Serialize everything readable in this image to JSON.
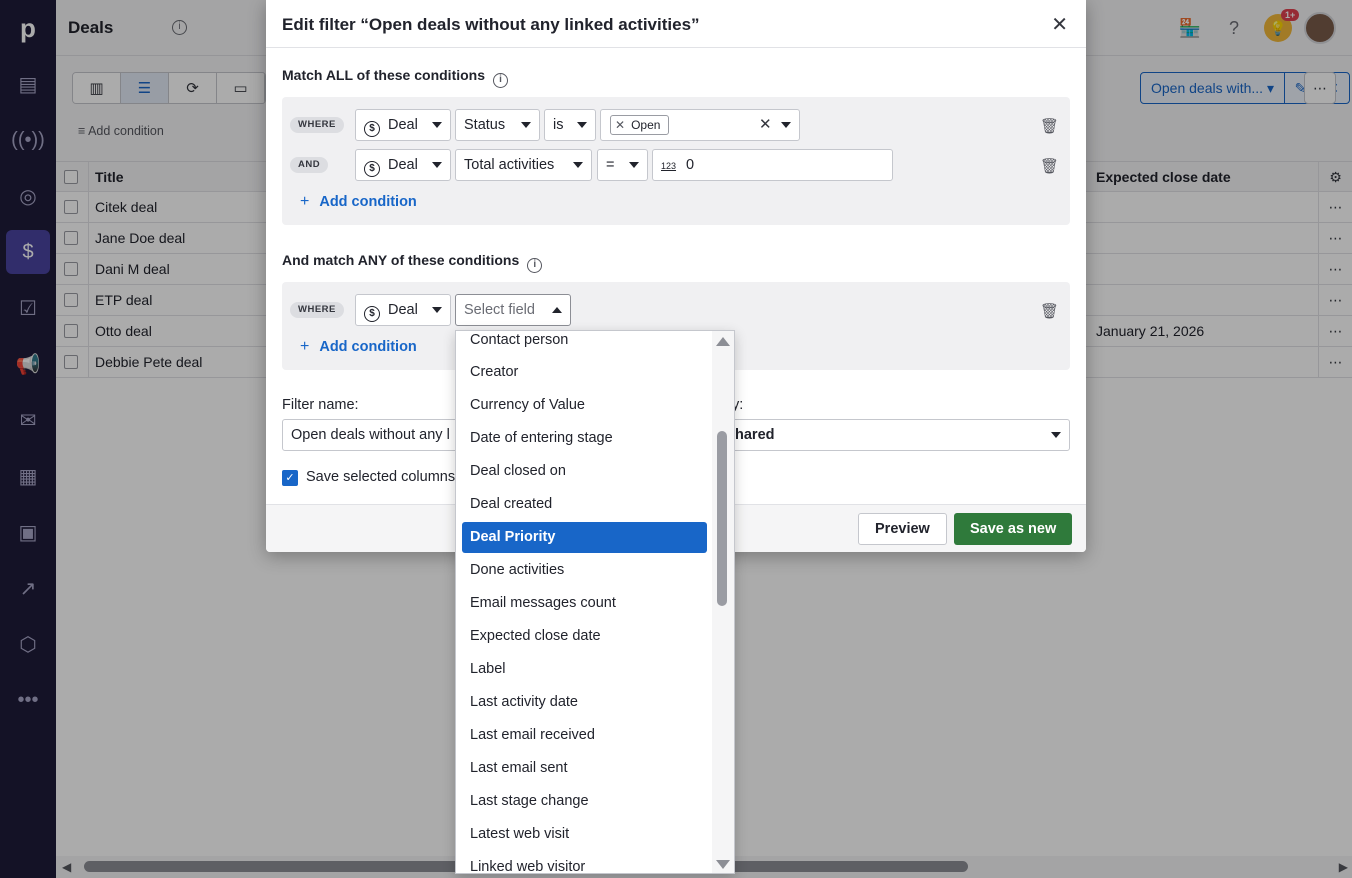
{
  "app": {
    "logo": "p",
    "page_title": "Deals",
    "notification_badge": "1+"
  },
  "nav": {
    "items": [
      "leads-icon",
      "radio-icon",
      "target-icon",
      "deals-icon",
      "tasks-icon",
      "campaigns-icon",
      "mail-icon",
      "calendar-icon",
      "contacts-icon",
      "insights-icon",
      "products-icon",
      "more-icon"
    ],
    "active": "deals-icon"
  },
  "toolbar": {
    "add_condition": "Add condition",
    "filter_name": "Open deals with...",
    "icons": [
      "pipeline-icon",
      "list-icon",
      "forecast-icon",
      "archive-icon"
    ]
  },
  "table": {
    "columns": {
      "title": "Title",
      "expected_close": "Expected close date"
    },
    "rows": [
      {
        "title": "Citek deal",
        "date": ""
      },
      {
        "title": "Jane Doe deal",
        "date": ""
      },
      {
        "title": "Dani M deal",
        "date": ""
      },
      {
        "title": "ETP deal",
        "date": ""
      },
      {
        "title": "Otto deal",
        "date": "January 21, 2026"
      },
      {
        "title": "Debbie Pete deal",
        "date": ""
      }
    ]
  },
  "modal": {
    "title": "Edit filter “Open deals without any linked activities”",
    "all_section": "Match ALL of these conditions",
    "any_section": "And match ANY of these conditions",
    "all_conditions": [
      {
        "tag": "WHERE",
        "entity": "Deal",
        "field": "Status",
        "operator": "is",
        "value_chip": "Open"
      },
      {
        "tag": "AND",
        "entity": "Deal",
        "field": "Total activities",
        "operator": "=",
        "value_prefix": "123",
        "value": "0"
      }
    ],
    "any_conditions": [
      {
        "tag": "WHERE",
        "entity": "Deal",
        "field_placeholder": "Select field"
      }
    ],
    "add_condition": "Add condition",
    "filter_name_label": "Filter name:",
    "filter_name_value": "Open deals without any l",
    "visibility_label_partial": "y:",
    "visibility_value_partial": "hared",
    "save_columns_label": "Save selected columns",
    "preview_button": "Preview",
    "save_button": "Save as new"
  },
  "dropdown": {
    "options": [
      "Contact person",
      "Creator",
      "Currency of Value",
      "Date of entering stage",
      "Deal closed on",
      "Deal created",
      "Deal Priority",
      "Done activities",
      "Email messages count",
      "Expected close date",
      "Label",
      "Last activity date",
      "Last email received",
      "Last email sent",
      "Last stage change",
      "Latest web visit",
      "Linked web visitor"
    ],
    "selected": "Deal Priority"
  },
  "colors": {
    "nav_bg": "#1f1c3a",
    "accent_blue": "#1866c8",
    "save_green": "#2f7a3b"
  }
}
